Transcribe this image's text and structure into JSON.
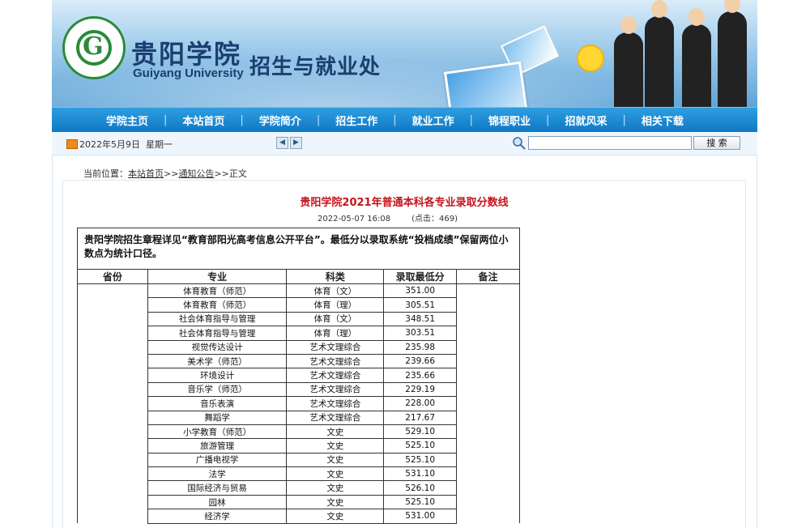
{
  "header": {
    "school_name_cn": "贵阳学院",
    "school_name_en": "Guiyang University",
    "office_name": "招生与就业处",
    "logo_letter": "G"
  },
  "nav": {
    "items": [
      {
        "label": "学院主页"
      },
      {
        "label": "本站首页"
      },
      {
        "label": "学院简介"
      },
      {
        "label": "招生工作"
      },
      {
        "label": "就业工作"
      },
      {
        "label": "锦程职业"
      },
      {
        "label": "招就风采"
      },
      {
        "label": "相关下载"
      }
    ],
    "separator": "|"
  },
  "infobar": {
    "date": "2022年5月9日",
    "weekday": "星期一",
    "search_value": "",
    "search_button": "搜 索"
  },
  "breadcrumb": {
    "prefix": "当前位置：",
    "home": "本站首页",
    "sep1": ">>",
    "section": "通知公告",
    "sep2": ">>",
    "current": "正文"
  },
  "article": {
    "title": "贵阳学院2021年普通本科各专业录取分数线",
    "datetime": "2022-05-07 16:08",
    "hits_label": "(点击：",
    "hits_value": "469",
    "hits_suffix": ")",
    "notice": "贵阳学院招生章程详见“教育部阳光高考信息公开平台”。最低分以录取系统“投档成绩”保留两位小数点为统计口径。"
  },
  "table": {
    "headers": [
      "省份",
      "专业",
      "科类",
      "录取最低分",
      "备注"
    ],
    "rows": [
      {
        "major": "体育教育（师范）",
        "category": "体育（文）",
        "score": "351.00"
      },
      {
        "major": "体育教育（师范）",
        "category": "体育（理）",
        "score": "305.51"
      },
      {
        "major": "社会体育指导与管理",
        "category": "体育（文）",
        "score": "348.51"
      },
      {
        "major": "社会体育指导与管理",
        "category": "体育（理）",
        "score": "303.51"
      },
      {
        "major": "视觉传达设计",
        "category": "艺术文理综合",
        "score": "235.98"
      },
      {
        "major": "美术学（师范）",
        "category": "艺术文理综合",
        "score": "239.66"
      },
      {
        "major": "环境设计",
        "category": "艺术文理综合",
        "score": "235.66"
      },
      {
        "major": "音乐学（师范）",
        "category": "艺术文理综合",
        "score": "229.19"
      },
      {
        "major": "音乐表演",
        "category": "艺术文理综合",
        "score": "228.00"
      },
      {
        "major": "舞蹈学",
        "category": "艺术文理综合",
        "score": "217.67"
      },
      {
        "major": "小学教育（师范）",
        "category": "文史",
        "score": "529.10"
      },
      {
        "major": "旅游管理",
        "category": "文史",
        "score": "525.10"
      },
      {
        "major": "广播电视学",
        "category": "文史",
        "score": "525.10"
      },
      {
        "major": "法学",
        "category": "文史",
        "score": "531.10"
      },
      {
        "major": "国际经济与贸易",
        "category": "文史",
        "score": "526.10"
      },
      {
        "major": "园林",
        "category": "文史",
        "score": "525.10"
      },
      {
        "major": "经济学",
        "category": "文史",
        "score": "531.00"
      }
    ]
  }
}
